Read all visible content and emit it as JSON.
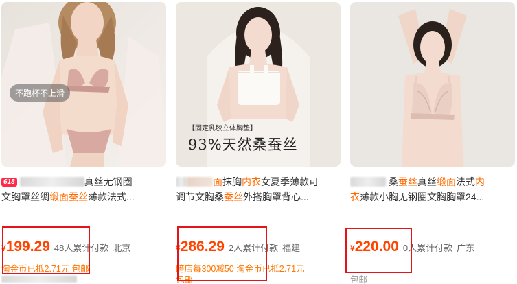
{
  "products": [
    {
      "image_tag": "不跑杯不上滑",
      "badge": "618",
      "title_line1_suffix": "真丝无钢圈",
      "title_line2_part1": "文胸罩丝绸",
      "title_line2_highlight": "缎面蚕丝",
      "title_line2_part2": "薄款法式...",
      "currency": "¥",
      "price": "199.29",
      "sales": "48人累计付款",
      "location": "北京",
      "promo_line1": "淘金币已抵2.71元  包邮"
    },
    {
      "image_caption_small": "【固定乳胶立体胸垫】",
      "image_caption_big": "93%天然桑蚕丝",
      "title_line1_highlight": "面",
      "title_line1_part2": "抹胸",
      "title_line1_highlight2": "内衣",
      "title_line1_part3": "女夏季薄款可",
      "title_line2_part1": "调节文胸桑",
      "title_line2_highlight": "蚕丝",
      "title_line2_part2": "外搭胸罩背心...",
      "currency": "¥",
      "price": "286.29",
      "sales": "2人累计付款",
      "location": "福建",
      "promo_line1": "跨店每300减50  淘金币已抵2.71元",
      "promo_line2": "包邮"
    },
    {
      "title_line1_part1": "桑",
      "title_line1_highlight": "蚕丝",
      "title_line1_part2": "真丝",
      "title_line1_highlight2": "缎面",
      "title_line1_part3": "法式",
      "title_line1_highlight3": "内",
      "title_line2_highlight": "衣",
      "title_line2_part1": "薄款小胸无钢圈文胸胸罩24...",
      "currency": "¥",
      "price": "220.00",
      "sales": "0人累计付款",
      "location": "广东",
      "promo_line1": "包邮"
    }
  ]
}
